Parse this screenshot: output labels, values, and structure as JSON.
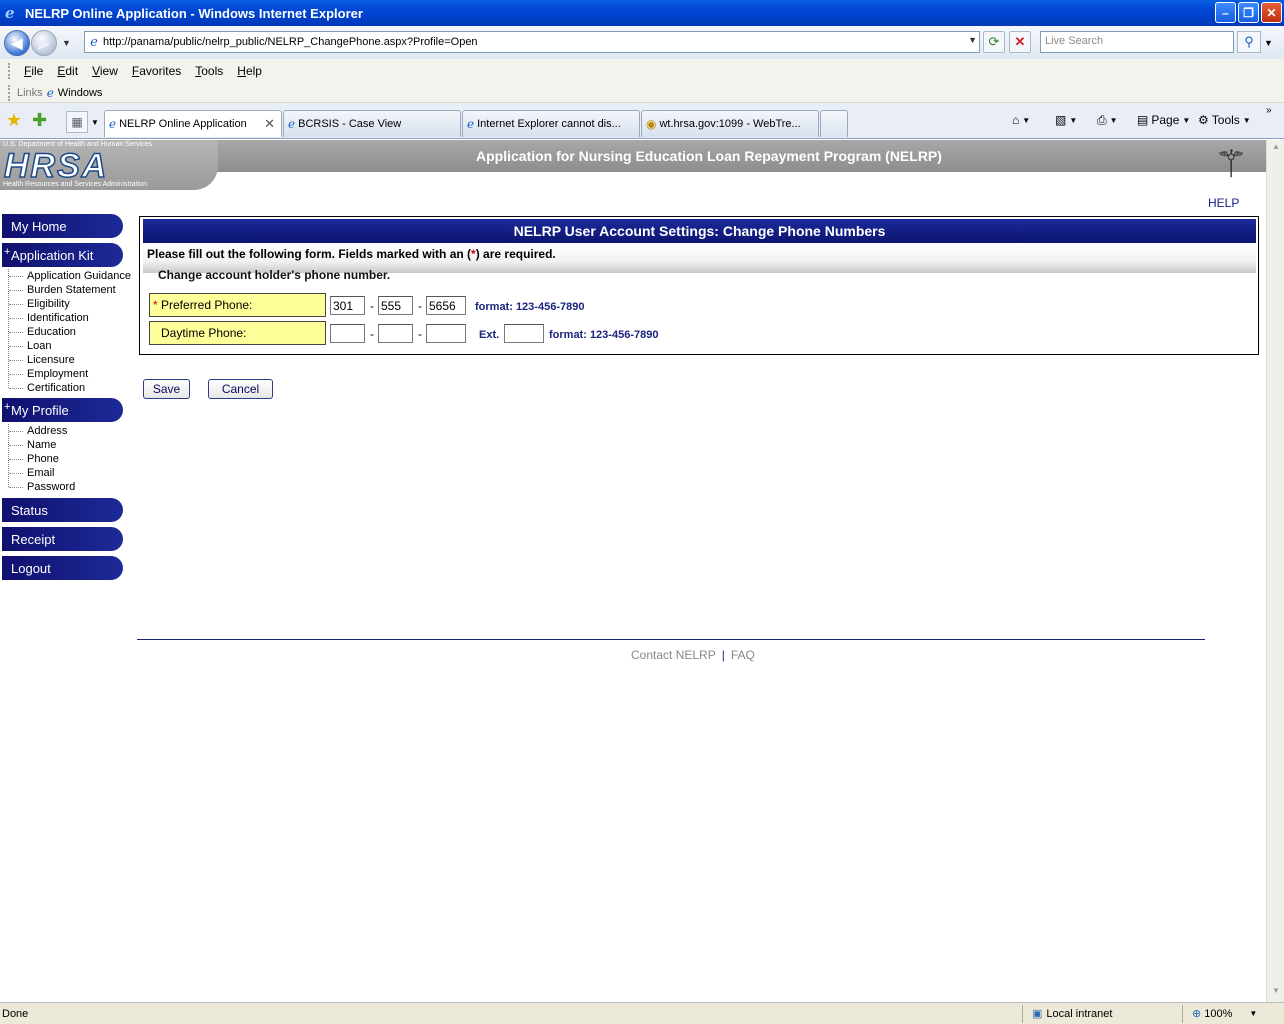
{
  "window": {
    "title": "NELRP Online Application - Windows Internet Explorer",
    "min_label": "–",
    "max_label": "❐",
    "close_label": "✕"
  },
  "nav": {
    "address": "http://panama/public/nelrp_public/NELRP_ChangePhone.aspx?Profile=Open",
    "search_placeholder": "Live Search"
  },
  "menu": [
    "File",
    "Edit",
    "View",
    "Favorites",
    "Tools",
    "Help"
  ],
  "links": {
    "label": "Links",
    "item": "Windows"
  },
  "tabs": [
    {
      "label": "NELRP Online Application",
      "icon": "ie-icon"
    },
    {
      "label": "BCRSIS - Case View",
      "icon": "ie-icon"
    },
    {
      "label": "Internet Explorer cannot dis...",
      "icon": "ie-icon"
    },
    {
      "label": "wt.hrsa.gov:1099 - WebTre...",
      "icon": "hrsa-icon"
    }
  ],
  "commands": {
    "page": "Page",
    "tools": "Tools"
  },
  "header": {
    "dept": "U.S. Department of Health and Human Services",
    "logo": "HRSA",
    "admin": "Health Resources and Services Administration",
    "app_title": "Application for Nursing Education Loan Repayment Program (NELRP)",
    "help": "HELP"
  },
  "sidebar": {
    "my_home": "My Home",
    "application_kit": "Application Kit",
    "kit_items": [
      "Application Guidance",
      "Burden Statement",
      "Eligibility",
      "Identification",
      "Education",
      "Loan",
      "Licensure",
      "Employment",
      "Certification"
    ],
    "my_profile": "My Profile",
    "profile_items": [
      "Address",
      "Name",
      "Phone",
      "Email",
      "Password"
    ],
    "status": "Status",
    "receipt": "Receipt",
    "logout": "Logout"
  },
  "form": {
    "title": "NELRP User Account Settings: Change Phone Numbers",
    "instructions_pre": "Please fill out the following form. Fields marked with an (",
    "instructions_star": "*",
    "instructions_post": ") are required.",
    "subheading": "Change account holder's phone number.",
    "preferred": {
      "star": "*",
      "label": " Preferred Phone:",
      "area": "301",
      "prefix": "555",
      "line": "5656",
      "format": "format:  123-456-7890"
    },
    "daytime": {
      "label": "Daytime Phone:",
      "area": "",
      "prefix": "",
      "line": "",
      "ext_label": "Ext.",
      "ext": "",
      "format": "format:  123-456-7890"
    },
    "dash": "-",
    "save": "Save",
    "cancel": "Cancel"
  },
  "footer": {
    "contact": "Contact NELRP",
    "sep": "|",
    "faq": "FAQ"
  },
  "status": {
    "text": "Done",
    "zone": "Local intranet",
    "zoom": "100%"
  }
}
